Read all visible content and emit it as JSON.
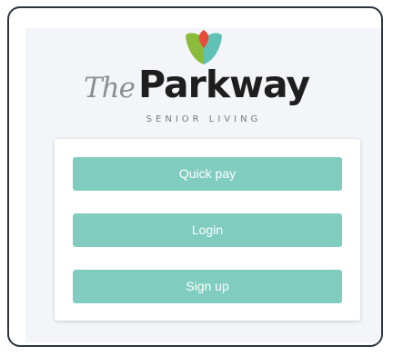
{
  "brand": {
    "the": "The",
    "name": "Parkway",
    "tagline": "SENIOR LIVING",
    "colors": {
      "leaf_left": "#8bbb3a",
      "leaf_right": "#5fc2b4",
      "leaf_top": "#e84b3c"
    }
  },
  "actions": {
    "quick_pay_label": "Quick pay",
    "login_label": "Login",
    "signup_label": "Sign up"
  },
  "colors": {
    "button": "#80cdbf",
    "frame_border": "#2c3440",
    "panel_bg": "#f4f5f8"
  }
}
